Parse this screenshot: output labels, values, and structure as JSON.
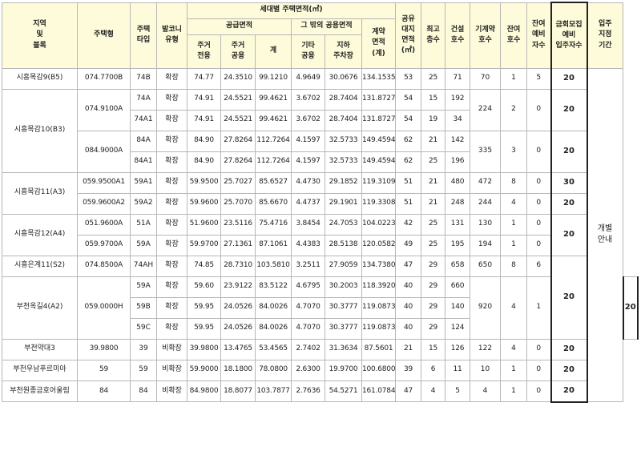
{
  "headers": {
    "region": "지역\n및\n블록",
    "housing_type": "주택형",
    "housing_unit_type": "주택\n타입",
    "balcony_type": "발코니\n유형",
    "area_group": "세대별 주택면적(㎡)",
    "supply_area": "공급면적",
    "other_common_area": "그 밖의 공용면적",
    "residential_exclusive": "주거\n전용",
    "residential_common": "주거\n공용",
    "supply_total": "계",
    "other_common": "기타\n공용",
    "underground_parking": "지하\n주차장",
    "contract_area": "계약\n면적\n(계)",
    "land_share": "공유\n대지\n면적\n(㎡)",
    "top_floor": "최고\n층수",
    "built_units": "건설\n호수",
    "existing_contract": "기계약\n호수",
    "remaining_units": "잔여\n호수",
    "remaining_reserve": "잔여\n예비\n자수",
    "recruit_reserve": "금회모집\n예비\n입주자수",
    "move_in_period": "입주\n지정\n기간"
  },
  "move_in_note": "개별\n안내",
  "groups": [
    {
      "region": "시흥목감9(B5)",
      "subs": [
        {
          "housing_type": "074.7700B",
          "rows": [
            {
              "unit_type": "74B",
              "balcony": "확장",
              "exclusive": "74.77",
              "res_common": "24.3510",
              "supply_total": "99.1210",
              "other_common": "4.9649",
              "parking": "30.0676",
              "contract": "134.1535",
              "land": "53",
              "floors": "25",
              "units": "71"
            }
          ]
        }
      ],
      "existing_contract": "70",
      "remaining": "1",
      "reserve": "5",
      "recruit": "20"
    },
    {
      "region": "시흥목감10(B3)",
      "subs": [
        {
          "housing_type": "074.9100A",
          "rows": [
            {
              "unit_type": "74A",
              "balcony": "확장",
              "exclusive": "74.91",
              "res_common": "24.5521",
              "supply_total": "99.4621",
              "other_common": "3.6702",
              "parking": "28.7404",
              "contract": "131.8727",
              "land": "54",
              "floors": "15",
              "units": "192"
            },
            {
              "unit_type": "74A1",
              "balcony": "확장",
              "exclusive": "74.91",
              "res_common": "24.5521",
              "supply_total": "99.4621",
              "other_common": "3.6702",
              "parking": "28.7404",
              "contract": "131.8727",
              "land": "54",
              "floors": "19",
              "units": "34"
            }
          ],
          "existing_contract": "224",
          "remaining": "2",
          "reserve": "0",
          "recruit": "20"
        },
        {
          "housing_type": "084.9000A",
          "rows": [
            {
              "unit_type": "84A",
              "balcony": "확장",
              "exclusive": "84.90",
              "res_common": "27.8264",
              "supply_total": "112.7264",
              "other_common": "4.1597",
              "parking": "32.5733",
              "contract": "149.4594",
              "land": "62",
              "floors": "21",
              "units": "142"
            },
            {
              "unit_type": "84A1",
              "balcony": "확장",
              "exclusive": "84.90",
              "res_common": "27.8264",
              "supply_total": "112.7264",
              "other_common": "4.1597",
              "parking": "32.5733",
              "contract": "149.4594",
              "land": "62",
              "floors": "25",
              "units": "196"
            }
          ],
          "existing_contract": "335",
          "remaining": "3",
          "reserve": "0",
          "recruit": "20"
        }
      ]
    },
    {
      "region": "시흥목감11(A3)",
      "subs": [
        {
          "housing_type": "059.9500A1",
          "rows": [
            {
              "unit_type": "59A1",
              "balcony": "확장",
              "exclusive": "59.9500",
              "res_common": "25.7027",
              "supply_total": "85.6527",
              "other_common": "4.4730",
              "parking": "29.1852",
              "contract": "119.3109",
              "land": "51",
              "floors": "21",
              "units": "480",
              "existing_contract": "472",
              "remaining": "8",
              "reserve": "0",
              "recruit": "30"
            }
          ]
        },
        {
          "housing_type": "059.9600A2",
          "rows": [
            {
              "unit_type": "59A2",
              "balcony": "확장",
              "exclusive": "59.9600",
              "res_common": "25.7070",
              "supply_total": "85.6670",
              "other_common": "4.4737",
              "parking": "29.1901",
              "contract": "119.3308",
              "land": "51",
              "floors": "21",
              "units": "248",
              "existing_contract": "244",
              "remaining": "4",
              "reserve": "0"
            }
          ]
        }
      ],
      "recruit_bottom": "20"
    },
    {
      "region": "시흥목감12(A4)",
      "subs": [
        {
          "housing_type": "051.9600A",
          "rows": [
            {
              "unit_type": "51A",
              "balcony": "확장",
              "exclusive": "51.9600",
              "res_common": "23.5116",
              "supply_total": "75.4716",
              "other_common": "3.8454",
              "parking": "24.7053",
              "contract": "104.0223",
              "land": "42",
              "floors": "25",
              "units": "131",
              "existing_contract": "130",
              "remaining": "1",
              "reserve": "0"
            }
          ]
        },
        {
          "housing_type": "059.9700A",
          "rows": [
            {
              "unit_type": "59A",
              "balcony": "확장",
              "exclusive": "59.9700",
              "res_common": "27.1361",
              "supply_total": "87.1061",
              "other_common": "4.4383",
              "parking": "28.5138",
              "contract": "120.0582",
              "land": "49",
              "floors": "25",
              "units": "195",
              "existing_contract": "194",
              "remaining": "1",
              "reserve": "0"
            }
          ]
        }
      ],
      "recruit": "20"
    },
    {
      "region": "시흥은계11(S2)",
      "subs": [
        {
          "housing_type": "074.8500A",
          "rows": [
            {
              "unit_type": "74AH",
              "balcony": "확장",
              "exclusive": "74.85",
              "res_common": "28.7310",
              "supply_total": "103.5810",
              "other_common": "3.2511",
              "parking": "27.9059",
              "contract": "134.7380",
              "land": "47",
              "floors": "29",
              "units": "658"
            }
          ]
        }
      ],
      "existing_contract": "650",
      "remaining": "8",
      "reserve": "6"
    },
    {
      "region": "부천옥길4(A2)",
      "subs": [
        {
          "housing_type": "059.0000H",
          "rows": [
            {
              "unit_type": "59A",
              "balcony": "확장",
              "exclusive": "59.60",
              "res_common": "23.9122",
              "supply_total": "83.5122",
              "other_common": "4.6795",
              "parking": "30.2003",
              "contract": "118.3920",
              "land": "40",
              "floors": "29",
              "units": "660"
            },
            {
              "unit_type": "59B",
              "balcony": "확장",
              "exclusive": "59.95",
              "res_common": "24.0526",
              "supply_total": "84.0026",
              "other_common": "4.7070",
              "parking": "30.3777",
              "contract": "119.0873",
              "land": "40",
              "floors": "29",
              "units": "140"
            },
            {
              "unit_type": "59C",
              "balcony": "확장",
              "exclusive": "59.95",
              "res_common": "24.0526",
              "supply_total": "84.0026",
              "other_common": "4.7070",
              "parking": "30.3777",
              "contract": "119.0873",
              "land": "40",
              "floors": "29",
              "units": "124"
            }
          ]
        }
      ],
      "existing_contract": "920",
      "remaining": "4",
      "reserve": "1",
      "recruit": "20"
    },
    {
      "region": "부천약대3",
      "subs": [
        {
          "housing_type": "39.9800",
          "rows": [
            {
              "unit_type": "39",
              "balcony": "비확장",
              "exclusive": "39.9800",
              "res_common": "13.4765",
              "supply_total": "53.4565",
              "other_common": "2.7402",
              "parking": "31.3634",
              "contract": "87.5601",
              "land": "21",
              "floors": "15",
              "units": "126"
            }
          ]
        }
      ],
      "existing_contract": "122",
      "remaining": "4",
      "reserve": "0",
      "recruit": "20"
    },
    {
      "region": "부천우남푸르미아",
      "subs": [
        {
          "housing_type": "59",
          "rows": [
            {
              "unit_type": "59",
              "balcony": "비확장",
              "exclusive": "59.9000",
              "res_common": "18.1800",
              "supply_total": "78.0800",
              "other_common": "2.6300",
              "parking": "19.9700",
              "contract": "100.6800",
              "land": "39",
              "floors": "6",
              "units": "11"
            }
          ]
        }
      ],
      "existing_contract": "10",
      "remaining": "1",
      "reserve": "0",
      "recruit": "20"
    },
    {
      "region": "부천원종금호어울림",
      "subs": [
        {
          "housing_type": "84",
          "rows": [
            {
              "unit_type": "84",
              "balcony": "비확장",
              "exclusive": "84.9800",
              "res_common": "18.8077",
              "supply_total": "103.7877",
              "other_common": "2.7636",
              "parking": "54.5271",
              "contract": "161.0784",
              "land": "47",
              "floors": "4",
              "units": "5"
            }
          ]
        }
      ],
      "existing_contract": "4",
      "remaining": "1",
      "reserve": "0",
      "recruit": "20"
    }
  ]
}
